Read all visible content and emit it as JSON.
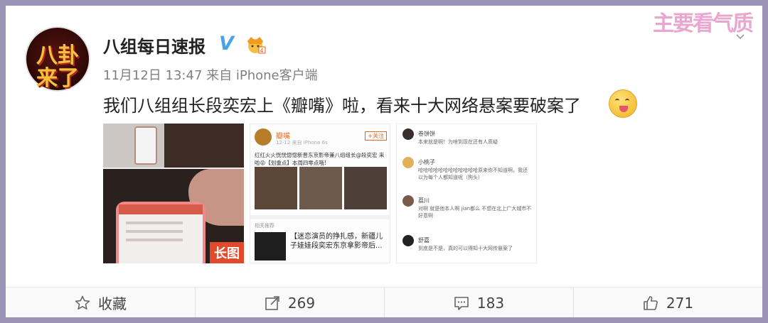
{
  "colors": {
    "frame": "#9b93b5",
    "verified": "#4aa3e8",
    "text": "#222222",
    "meta": "#808080",
    "watermark": "#e9a6cf",
    "accent": "#e14b2b"
  },
  "watermark": "主要看气质",
  "post": {
    "avatar_lines": [
      "八卦",
      "来了"
    ],
    "username": "八组每日速报",
    "verified_icon": "V",
    "timeline": "11月12日 13:47 来自 iPhone客户端",
    "content": "我们八组组长段奕宏上《瓣嘴》啦，看来十大网络悬案要破案了"
  },
  "images": {
    "long_label": "长图",
    "second": {
      "name": "瓣嘴",
      "sub": "12-12 来自 iPhone 6s",
      "follow": "+关注",
      "text": "红红火火恍恍惚惚新晋东京影帝兼八组组长@段奕宏 来啦😝【划重点】本周四零点哦!",
      "related": "相关推荐",
      "article": "【迷恋演员的挣扎感，新疆儿子娃娃段奕宏东京拿影帝后..."
    },
    "third": {
      "comments": [
        {
          "name": "卷饼饼",
          "text": "本来就是啊！为啥到现在还有人质疑"
        },
        {
          "name": "小桃子",
          "text": "哈哈哈哈哈哈哈哈哈哈哈哈原来你不知道啊，我还以为每个人都知道呢（狗头）"
        },
        {
          "name": "荔川",
          "text": "对啊 就是他本人啊 jian都么 不想在北上广大城市不好意啊"
        },
        {
          "name": "舒嘉",
          "text": "到底是不是，真的可以得知十大网传悬案了"
        }
      ]
    }
  },
  "actions": {
    "favorite_label": "收藏",
    "repost_count": "269",
    "comment_count": "183",
    "like_count": "271"
  }
}
